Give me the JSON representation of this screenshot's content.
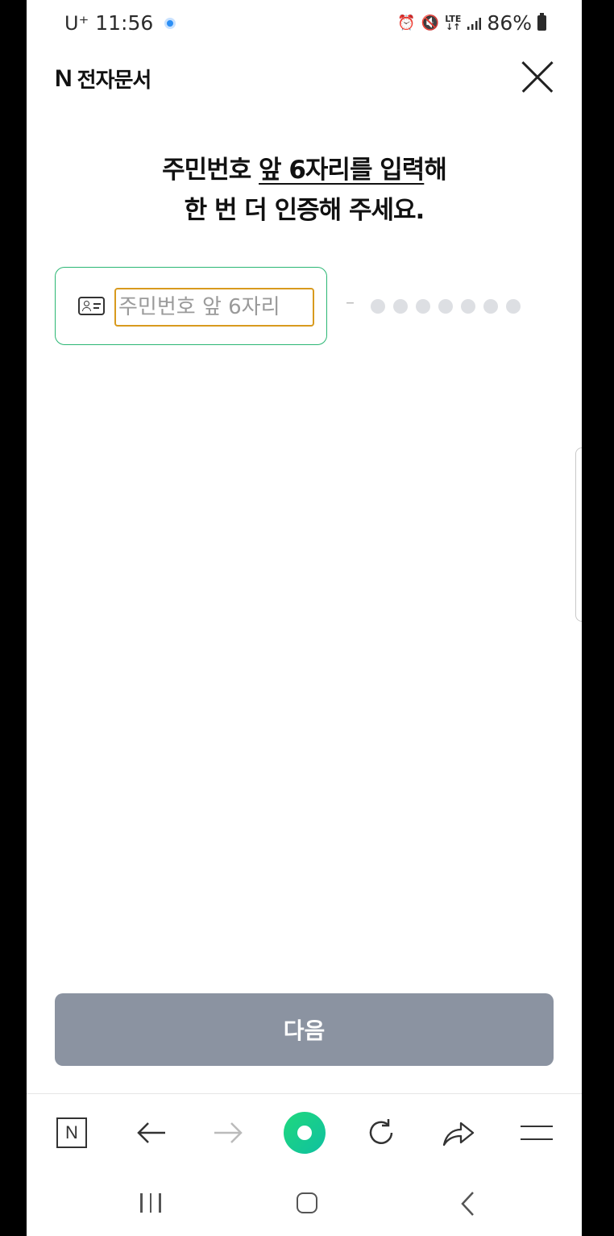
{
  "status_bar": {
    "carrier": "U⁺",
    "time": "11:56",
    "lte": "LTE",
    "battery": "86%"
  },
  "header": {
    "logo_letter": "N",
    "title": "전자문서"
  },
  "main": {
    "title_part1": "주민번호 ",
    "title_emph1": "앞 6자리를 입력",
    "title_part2": "해",
    "title_line2": "한 번 더 인증해 주세요.",
    "id_input": {
      "placeholder": "주민번호 앞 6자리",
      "value": ""
    },
    "separator": "–",
    "masked_digits": 7
  },
  "footer": {
    "next_label": "다음"
  },
  "browser_bar": {
    "n_label": "N",
    "items": [
      "n-menu",
      "back",
      "forward",
      "green-dot",
      "reload",
      "share",
      "menu"
    ]
  },
  "colors": {
    "accent_green": "#2ab673",
    "focus_orange": "#d89a1e",
    "button_disabled": "#8b93a1"
  }
}
